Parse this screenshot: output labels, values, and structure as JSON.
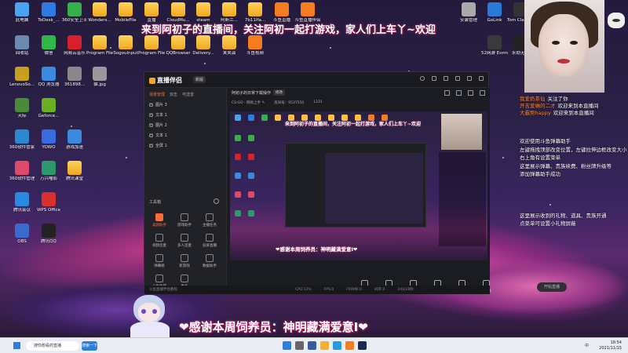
{
  "desktop_icons": [
    {
      "label": "此电脑",
      "color": "#4aa3f0"
    },
    {
      "label": "ToDesk_...",
      "color": "#2d7be0"
    },
    {
      "label": "360安全卫士",
      "color": "#36b04a"
    },
    {
      "label": "Wonders...",
      "color": "folder"
    },
    {
      "label": "MobileFile",
      "color": "folder"
    },
    {
      "label": "直播",
      "color": "folder"
    },
    {
      "label": "CloudMu...",
      "color": "folder"
    },
    {
      "label": "steam",
      "color": "folder"
    },
    {
      "label": "阿斯兰...",
      "color": "folder"
    },
    {
      "label": "7b11Ifa...",
      "color": "folder"
    },
    {
      "label": "斗鱼直播",
      "color": "#f57c20"
    },
    {
      "label": "斗鱼直播伴侣",
      "color": "#f57c20"
    },
    {
      "label": "回收站",
      "color": "#6a8ab0"
    },
    {
      "label": "微信",
      "color": "#2fb84a"
    },
    {
      "label": "网易云音乐",
      "color": "#d8202a"
    },
    {
      "label": "Program Files (x86)",
      "color": "folder"
    },
    {
      "label": "Sogoulnput",
      "color": "folder"
    },
    {
      "label": "Program Files",
      "color": "folder"
    },
    {
      "label": "QQBrowser",
      "color": "folder"
    },
    {
      "label": "Delivery...",
      "color": "folder"
    },
    {
      "label": "夹夹演",
      "color": "folder"
    },
    {
      "label": "斗鱼视频",
      "color": "#f57c20"
    },
    {
      "label": "LenovoSo...",
      "color": "#c8a020"
    },
    {
      "label": "QQ 浏览器",
      "color": "#3a8ae0"
    },
    {
      "label": "361898...",
      "color": "#888"
    },
    {
      "label": "猫.jpg",
      "color": "#999"
    },
    {
      "label": "天际",
      "color": "#4a8a3a"
    },
    {
      "label": "Geforce...",
      "color": "#6ab020"
    },
    {
      "label": "360软件管家",
      "color": "#2a8ad0"
    },
    {
      "label": "YOWO",
      "color": "#3a6ae0"
    },
    {
      "label": "游戏加速",
      "color": "#3a8ae0"
    },
    {
      "label": "360软件管理",
      "color": "#e04a6a"
    },
    {
      "label": "万兴喵影",
      "color": "#2a9a6a"
    },
    {
      "label": "腾讯课堂",
      "color": "folder"
    },
    {
      "label": "腾讯会议",
      "color": "#2a8ae0"
    },
    {
      "label": "WPS Office",
      "color": "#d8302a"
    },
    {
      "label": "OBS",
      "color": "#3a6ad0"
    },
    {
      "label": "腾讯QQ",
      "color": "#222"
    },
    {
      "label": "安装管理",
      "color": "#aaa"
    },
    {
      "label": "GoLink",
      "color": "#2a7ad8"
    },
    {
      "label": "Tom Clancy's",
      "color": "#333"
    },
    {
      "label": "52网游 Eorm...",
      "color": "#3a3a3a"
    },
    {
      "label": "永劫无间",
      "color": "#222"
    }
  ],
  "banner_text": "来到阿初子的直播间，关注阿初一起打游戏，家人们上车丫~欢迎",
  "thanks_text": "❤感谢本周饲养员：神明藏满爱意I❤",
  "app": {
    "title": "直播伴侣",
    "version": "新版",
    "side_tabs": [
      "场景管理",
      "双击",
      "可选音"
    ],
    "layers": [
      "图片 3",
      "文本 1",
      "图片 2",
      "文本 1",
      "全屏 1"
    ],
    "tools_title": "工具箱",
    "tools": [
      {
        "label": "美颜助手",
        "active": true
      },
      {
        "label": "游戏助手",
        "active": false
      },
      {
        "label": "主播任务",
        "active": false
      },
      {
        "label": "视频连麦",
        "active": false
      },
      {
        "label": "多人连麦",
        "active": false
      },
      {
        "label": "投屏直播",
        "active": false
      },
      {
        "label": "弹幕姬",
        "active": false
      },
      {
        "label": "新游戏",
        "active": false
      },
      {
        "label": "数据助手",
        "active": false
      },
      {
        "label": "斗鱼鱼吧",
        "active": false
      },
      {
        "label": "更多",
        "active": false
      }
    ],
    "stream_title": "阿初子的日常下载操作",
    "edit_label": "修改",
    "sub_info": [
      "CS:GO - 网易上手 ✎",
      "房间号：9537550",
      "1231"
    ],
    "bottom_buttons": [
      "直播背景",
      "摄像头",
      "手机投屏",
      "多媒体",
      "麦克风",
      "扬声器"
    ],
    "go_live_label": "开始直播",
    "status_items": [
      "斗鱼直播伴侣教程",
      "CPU:12%",
      "FPS:0",
      "FRAME:0",
      "码率:0",
      "24分28秒"
    ]
  },
  "preview": {
    "banner": "来到阿初子的直播间，关注阿初一起打游戏，家人们上车丫~欢迎",
    "thanks": "❤感谢本周饲养员：神明藏满爱意I❤"
  },
  "chat": {
    "messages": [
      {
        "user": "我爱奶茶仙",
        "msg": "关注了你"
      },
      {
        "user": "开吉爱琳的二才",
        "msg": "欢迎来到本直播间"
      },
      {
        "user": "大霸势happy",
        "msg": "欢迎来到本直播间"
      }
    ],
    "notice_lines": [
      "欢迎使用斗鱼弹幕助手",
      "左键拖拽顶部改变位置，左键拉伸边框改变大小",
      "右上角有设置菜单",
      "这里展示弹幕、贵族续费、粉丝牌升级等",
      "添加弹幕助手成功"
    ],
    "notice_bottom": [
      "这里展示收到的礼物、道具、贵族开通",
      "点菜单可设置小礼物屏蔽"
    ]
  },
  "taskbar": {
    "search_placeholder": "搜你想看的直播",
    "button_label": "搜索一下",
    "time": "18:54",
    "date": "2021/11/15",
    "tray_text": "中"
  }
}
